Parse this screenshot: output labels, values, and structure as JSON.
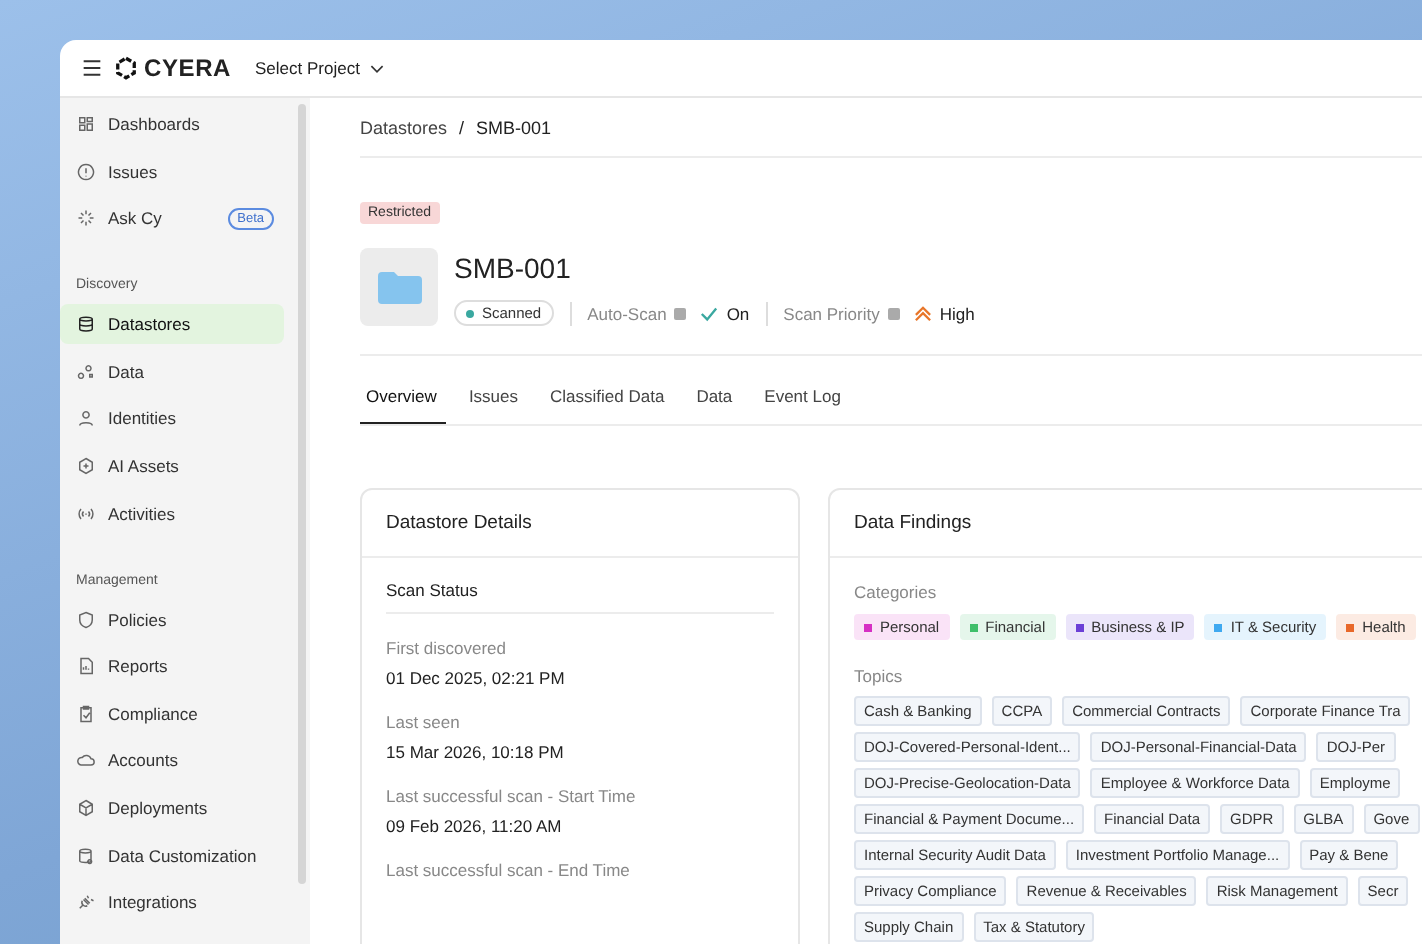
{
  "topbar": {
    "brand": "CYERA",
    "project_select": "Select Project"
  },
  "sidebar": {
    "groups": [
      {
        "items": [
          {
            "label": "Dashboards",
            "selected": false
          },
          {
            "label": "Issues",
            "selected": false
          },
          {
            "label": "Ask Cy",
            "selected": false,
            "badge": "Beta"
          }
        ]
      },
      {
        "label": "Discovery",
        "items": [
          {
            "label": "Datastores",
            "selected": true
          },
          {
            "label": "Data",
            "selected": false
          },
          {
            "label": "Identities",
            "selected": false
          },
          {
            "label": "AI Assets",
            "selected": false
          },
          {
            "label": "Activities",
            "selected": false
          }
        ]
      },
      {
        "label": "Management",
        "items": [
          {
            "label": "Policies",
            "selected": false
          },
          {
            "label": "Reports",
            "selected": false
          },
          {
            "label": "Compliance",
            "selected": false
          },
          {
            "label": "Accounts",
            "selected": false
          },
          {
            "label": "Deployments",
            "selected": false
          },
          {
            "label": "Data Customization",
            "selected": false
          },
          {
            "label": "Integrations",
            "selected": false
          }
        ]
      }
    ]
  },
  "breadcrumb": {
    "separator": "/",
    "items": [
      "Datastores",
      "SMB-001"
    ]
  },
  "header": {
    "sensitivity": "Restricted",
    "title": "SMB-001",
    "status": "Scanned",
    "auto_scan_label": "Auto-Scan",
    "auto_scan_value": "On",
    "priority_label": "Scan Priority",
    "priority_value": "High"
  },
  "tabs": [
    {
      "label": "Overview",
      "selected": true
    },
    {
      "label": "Issues",
      "selected": false
    },
    {
      "label": "Classified Data",
      "selected": false
    },
    {
      "label": "Data",
      "selected": false
    },
    {
      "label": "Event Log",
      "selected": false
    }
  ],
  "details": {
    "title": "Datastore Details",
    "section": "Scan Status",
    "fields": [
      {
        "label": "First discovered",
        "value": "01 Dec 2025, 02:21 PM"
      },
      {
        "label": "Last seen",
        "value": "15 Mar 2026, 10:18 PM"
      },
      {
        "label": "Last successful scan - Start Time",
        "value": "09 Feb 2026, 11:20 AM"
      },
      {
        "label": "Last successful scan - End Time"
      }
    ]
  },
  "findings": {
    "title": "Data Findings",
    "categories_label": "Categories",
    "categories": [
      {
        "label": "Personal",
        "color": "#d62fc4"
      },
      {
        "label": "Financial",
        "color": "#3fbf6a"
      },
      {
        "label": "Business & IP",
        "color": "#6b3fd6"
      },
      {
        "label": "IT & Security",
        "color": "#3fa9f0"
      },
      {
        "label": "Health",
        "color": "#e8682a"
      }
    ],
    "topics_label": "Topics",
    "topic_rows": [
      [
        "Cash & Banking",
        "CCPA",
        "Commercial Contracts",
        "Corporate Finance Tra"
      ],
      [
        "DOJ-Covered-Personal-Ident...",
        "DOJ-Personal-Financial-Data",
        "DOJ-Per"
      ],
      [
        "DOJ-Precise-Geolocation-Data",
        "Employee & Workforce Data",
        "Employme"
      ],
      [
        "Financial & Payment Docume...",
        "Financial Data",
        "GDPR",
        "GLBA",
        "Gove"
      ],
      [
        "Internal Security Audit Data",
        "Investment Portfolio Manage...",
        "Pay & Bene"
      ],
      [
        "Privacy Compliance",
        "Revenue & Receivables",
        "Risk Management",
        "Secr"
      ],
      [
        "Supply Chain",
        "Tax & Statutory"
      ]
    ]
  }
}
